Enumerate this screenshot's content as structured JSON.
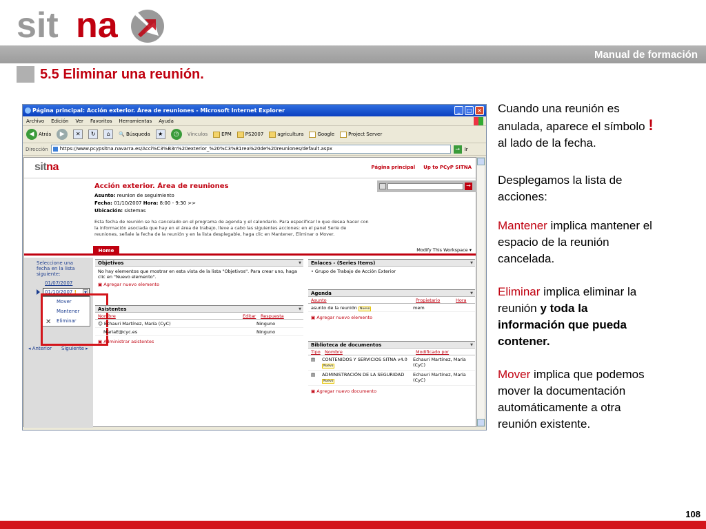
{
  "slide": {
    "logo_text_gray": "sit",
    "logo_text_red": "na",
    "header_label": "Manual de formación",
    "section_title": "5.5 Eliminar una reunión.",
    "page_number": "108"
  },
  "browser": {
    "window_title": "Página principal: Acción exterior. Área de reuniones - Microsoft Internet Explorer",
    "menu": [
      "Archivo",
      "Edición",
      "Ver",
      "Favoritos",
      "Herramientas",
      "Ayuda"
    ],
    "toolbar": {
      "back": "Atrás",
      "search": "Búsqueda",
      "links": "Vínculos",
      "epm": "EPM",
      "ps2007": "PS2007",
      "agricultura": "agricultura",
      "google": "Google",
      "project": "Project Server"
    },
    "address_label": "Dirección",
    "address_value": "https://www.pcypsitna.navarra.es/Acci%C3%B3n%20exterior_%20%C3%81rea%20de%20reuniones/default.aspx",
    "go_label": "Ir"
  },
  "sharepoint": {
    "logo_gray": "sit",
    "logo_red": "na",
    "toplink_home": "Página principal",
    "toplink_up": "Up to PCyP SITNA",
    "ws_title": "Acción exterior. Área de reuniones",
    "asunto_label": "Asunto:",
    "asunto_value": "reunion de seguimiento",
    "fecha_label": "Fecha:",
    "fecha_value": "01/10/2007",
    "hora_label": "Hora:",
    "hora_value": "8:00 - 9:30  >>",
    "ubicacion_label": "Ubicación:",
    "ubicacion_value": "sistemas",
    "description": "Esta fecha de reunión se ha cancelado en el programa de agenda y el calendario. Para especificar lo que desea hacer con la información asociada que hay en el área de trabajo, lleve a cabo las siguientes acciones: en el panel Serie de reuniones, señale la fecha de la reunión y en la lista desplegable, haga clic en Mantener, Eliminar o Mover.",
    "tab_home": "Home",
    "modify_label": "Modify This Workspace ▾",
    "left": {
      "select_text": "Seleccione una fecha en la lista siguiente:",
      "date1": "01/07/2007",
      "date2": "01/10/2007",
      "excl": "!",
      "actions": [
        "Mover",
        "Mantener",
        "Eliminar"
      ],
      "prev": "◂ Anterior",
      "next": "Siguiente ▸"
    },
    "objetivos": {
      "title": "Objetivos",
      "empty": "No hay elementos que mostrar en esta vista de la lista \"Objetivos\". Para crear uno, haga clic en \"Nuevo elemento\".",
      "add": "Agregar nuevo elemento"
    },
    "asistentes": {
      "title": "Asistentes",
      "col_name": "Nombre",
      "col_edit": "Editar",
      "col_resp": "Respuesta",
      "rows": [
        {
          "name": "Echauri Martínez, María (CyC)",
          "resp": "Ninguno"
        },
        {
          "name": "MariaE@cyc.es",
          "resp": "Ninguno"
        }
      ],
      "add": "Administrar asistentes"
    },
    "enlaces": {
      "title": "Enlaces - (Series Items)",
      "item": "Grupo de Trabajo de Acción Exterior"
    },
    "agenda": {
      "title": "Agenda",
      "col_asunto": "Asunto",
      "col_prop": "Propietario",
      "col_hora": "Hora",
      "row_asunto": "asunto de la reunión",
      "row_prop": "mem",
      "nuevo": "Nuevo",
      "add": "Agregar nuevo elemento"
    },
    "biblioteca": {
      "title": "Biblioteca de documentos",
      "col_tipo": "Tipo",
      "col_nombre": "Nombre",
      "col_mod": "Modificado por",
      "rows": [
        {
          "name": "CONTENIDOS Y SERVICIOS SITNA v4.0",
          "mod": "Echauri Martínez, María (CyC)"
        },
        {
          "name": "ADMINISTRACIÓN DE LA SEGURIDAD",
          "mod": "Echauri Martínez, María (CyC)"
        }
      ],
      "nuevo": "Nuevo",
      "add": "Agregar nuevo documento"
    }
  },
  "notes": {
    "p1a": "Cuando una reunión es",
    "p1b": "anulada, aparece el símbolo",
    "p1_bang": "!",
    "p1c": "al lado de la fecha.",
    "p2a": "Desplegamos la lista de",
    "p2b": "acciones:",
    "p3_red": "Mantener",
    "p3a": " implica mantener el",
    "p3b": "espacio de la reunión",
    "p3c": "cancelada.",
    "p4_red": "Eliminar",
    "p4a": " implica eliminar la",
    "p4b_plain": "reunión ",
    "p4b_bold": "y toda la",
    "p4c": "información que pueda",
    "p4d": "contener.",
    "p5_red": "Mover",
    "p5a": " implica que podemos",
    "p5b": "mover la documentación",
    "p5c": "automáticamente a otra",
    "p5d": "reunión existente."
  }
}
